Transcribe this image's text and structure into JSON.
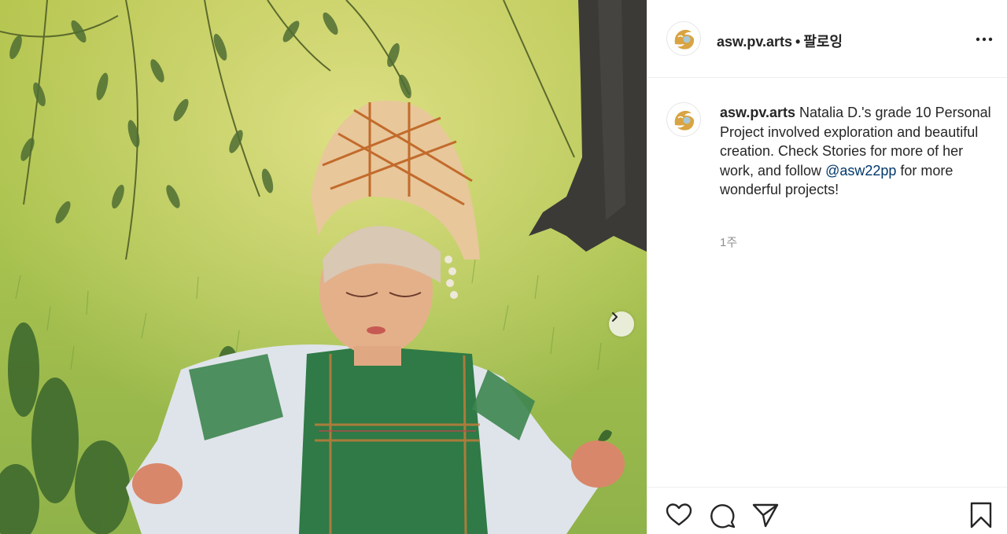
{
  "post": {
    "username": "asw.pv.arts",
    "separator": "•",
    "follow_label": "팔로잉",
    "caption_username": "asw.pv.arts",
    "caption_text_1": " Natalia D.'s grade 10 Personal Project involved exploration and beautiful creation. Check Stories for more of her work, and follow ",
    "mention": "@asw22pp",
    "caption_text_2": " for more wonderful projects!",
    "timestamp": "1주"
  },
  "icons": {
    "more": "more-options-icon",
    "next": "chevron-right-icon",
    "like": "heart-icon",
    "comment": "comment-bubble-icon",
    "share": "paper-plane-icon",
    "save": "bookmark-icon"
  },
  "colors": {
    "text": "#262626",
    "mention": "#00376b",
    "muted": "#8e8e8e",
    "divider": "#efefef",
    "logo_gold": "#d9a441"
  }
}
